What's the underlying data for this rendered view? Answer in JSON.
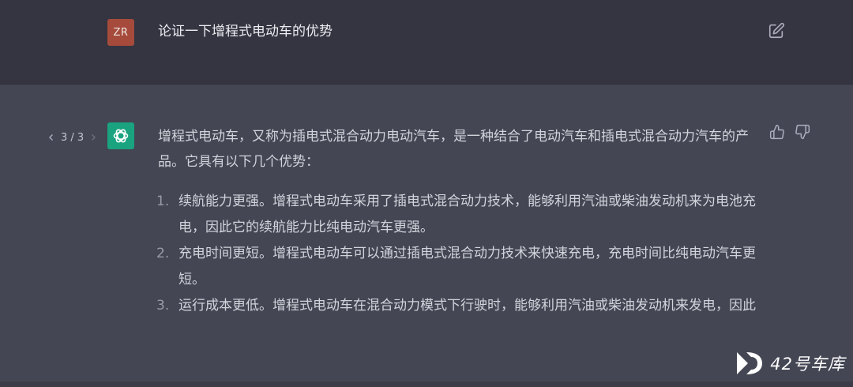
{
  "user_message": {
    "avatar_initials": "ZR",
    "text": "论证一下增程式电动车的优势"
  },
  "assistant_message": {
    "pager": {
      "current": "3 / 3"
    },
    "intro": "增程式电动车，又称为插电式混合动力电动汽车，是一种结合了电动汽车和插电式混合动力汽车的产品。它具有以下几个优势：",
    "points": [
      {
        "num": "1.",
        "text": "续航能力更强。增程式电动车采用了插电式混合动力技术，能够利用汽油或柴油发动机来为电池充电，因此它的续航能力比纯电动汽车更强。"
      },
      {
        "num": "2.",
        "text": "充电时间更短。增程式电动车可以通过插电式混合动力技术来快速充电，充电时间比纯电动汽车更短。"
      },
      {
        "num": "3.",
        "text": "运行成本更低。增程式电动车在混合动力模式下行驶时，能够利用汽油或柴油发动机来发电，因此"
      }
    ]
  },
  "icons": {
    "edit": "edit-icon",
    "thumbs_up": "thumbs-up-icon",
    "thumbs_down": "thumbs-down-icon",
    "openai_logo": "openai-logo-icon"
  },
  "watermark": {
    "text": "42号车库"
  },
  "colors": {
    "user_bg": "#343541",
    "assistant_bg": "#444654",
    "user_avatar": "#a64b3b",
    "bot_avatar": "#19a37f"
  }
}
